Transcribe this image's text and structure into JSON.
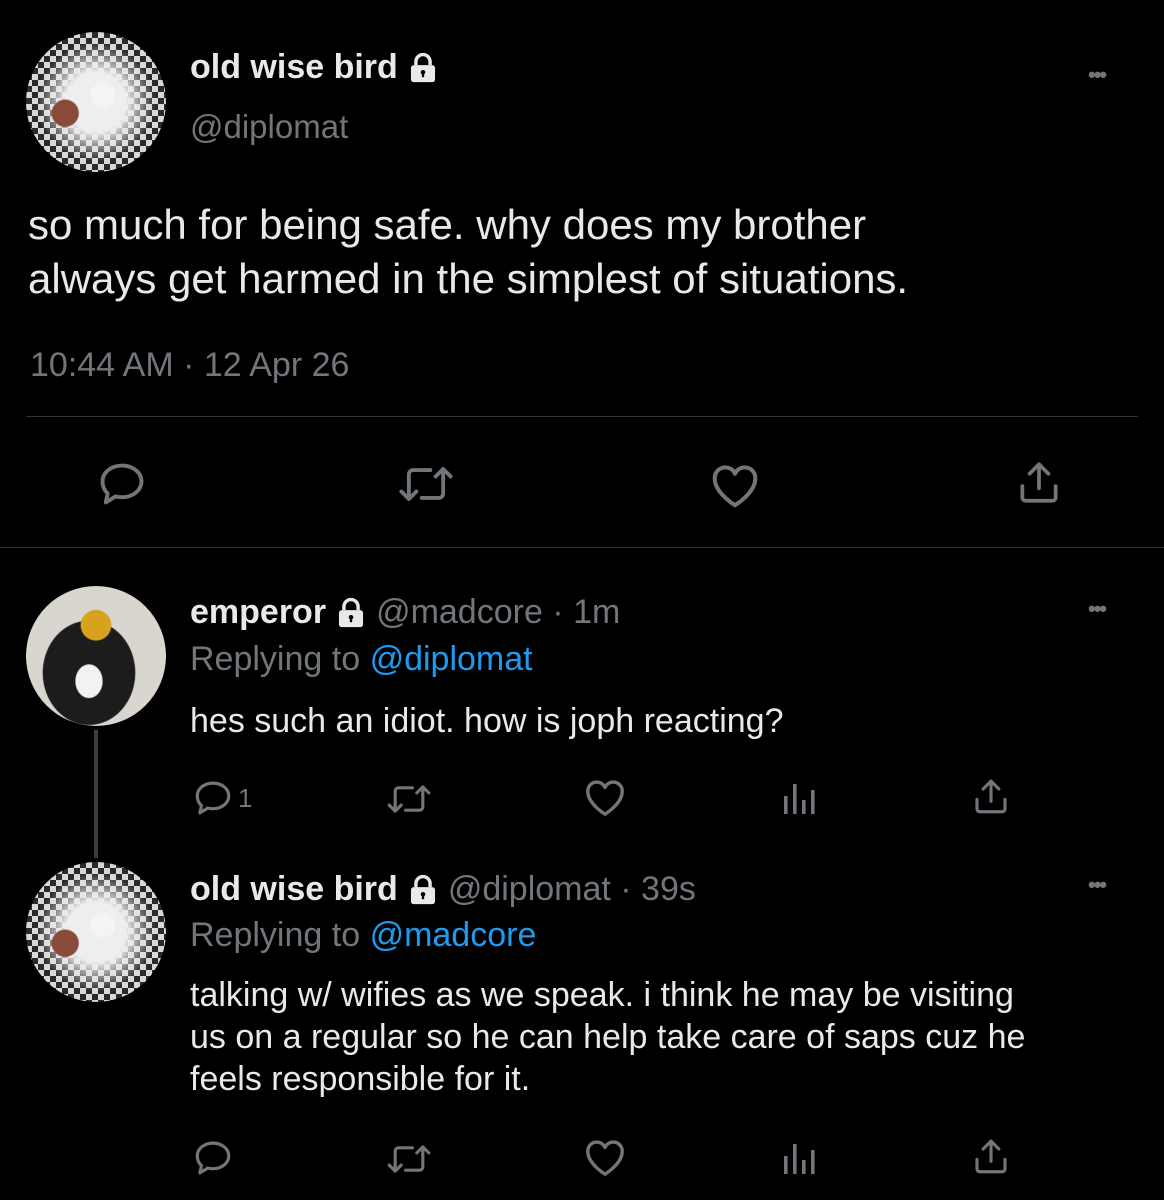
{
  "main_tweet": {
    "display_name": "old wise bird",
    "handle": "@diplomat",
    "text_lines": [
      "so much for being safe. why does my brother",
      "always get harmed in the simplest of situations."
    ],
    "timestamp": "10:44 AM · 12 Apr 26"
  },
  "reply_1": {
    "display_name": "emperor",
    "handle_time": "@madcore · 1m",
    "replying_prefix": "Replying to",
    "replying_handle": "@diplomat",
    "text_lines": [
      "hes such an idiot. how is joph reacting?"
    ],
    "reply_count": "1"
  },
  "reply_2": {
    "display_name": "old wise bird",
    "handle_time": "@diplomat · 39s",
    "replying_prefix": "Replying to",
    "replying_handle": "@madcore",
    "text_lines": [
      "talking w/ wifies as we speak. i think he may be visiting",
      "us on a regular so he can help take care of saps cuz he",
      "feels responsible for it."
    ]
  },
  "icons": {
    "more": "more-horizontal-icon",
    "reply": "reply-icon",
    "retweet": "retweet-icon",
    "like": "heart-icon",
    "share": "share-icon",
    "analytics": "analytics-icon",
    "lock": "lock-icon"
  },
  "colors": {
    "background": "#000000",
    "text": "#e7e9ea",
    "muted": "#71767b",
    "link": "#1d9bf0",
    "divider": "#2f3336"
  }
}
